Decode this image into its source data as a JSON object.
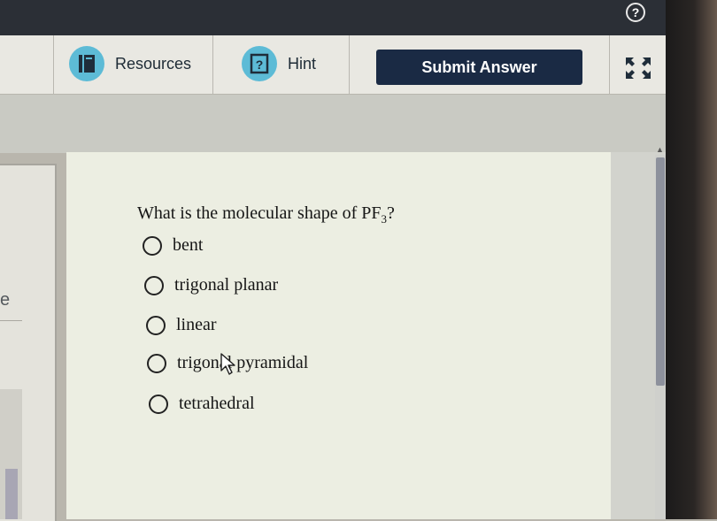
{
  "header": {
    "help_icon": "?"
  },
  "toolbar": {
    "resources_label": "Resources",
    "resources_icon": "book-icon",
    "hint_label": "Hint",
    "hint_icon": "question-box-icon",
    "submit_label": "Submit Answer",
    "expand_icon": "expand-icon"
  },
  "sidebar": {
    "partial_text": "e"
  },
  "question": {
    "text_before": "What is the molecular shape of PF",
    "subscript": "3",
    "text_after": "?",
    "options": [
      {
        "label": "bent"
      },
      {
        "label": "trigonal planar"
      },
      {
        "label": "linear"
      },
      {
        "label": "trigonal pyramidal"
      },
      {
        "label": "tetrahedral"
      }
    ]
  },
  "colors": {
    "submit_bg": "#1a2a44",
    "icon_bg": "#5dbbd6",
    "panel_bg": "#eceee2"
  }
}
